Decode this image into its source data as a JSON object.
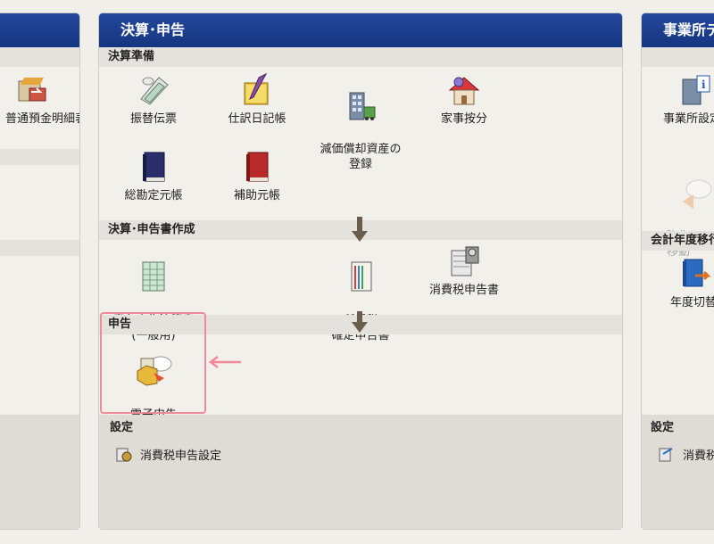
{
  "left_panel": {
    "item_label": "普通預金明細表"
  },
  "center_panel": {
    "title": "決算･申告",
    "sections": {
      "prep": "決算準備",
      "create": "決算･申告書作成",
      "filing": "申告",
      "settings": "設定"
    },
    "items": {
      "transfer_slip": "振替伝票",
      "journal": "仕訳日記帳",
      "depreciation": "減価償却資産の\n登録",
      "household_allocation": "家事按分",
      "general_ledger": "総勘定元帳",
      "sub_ledger": "補助元帳",
      "blue_return": "青色申告決算書\n(一般用)",
      "income_tax_return": "所得税\n確定申告書",
      "consumption_tax_return": "消費税申告書",
      "e_filing": "電子申告\n(e-Tax)",
      "consumption_tax_settings": "消費税申告設定"
    }
  },
  "right_panel": {
    "title": "事業所データ",
    "items": {
      "office_settings": "事業所設定",
      "drive_move": "弥生ドライブ\n移動",
      "fiscal_section": "会計年度移行",
      "year_switch": "年度切替",
      "settings_section": "設定",
      "consumption_tax_row": "消費税"
    }
  },
  "colors": {
    "header_blue": "#1c3d8c",
    "highlight_pink": "#f08a9a",
    "arrow_brown": "#6b5d4b"
  }
}
